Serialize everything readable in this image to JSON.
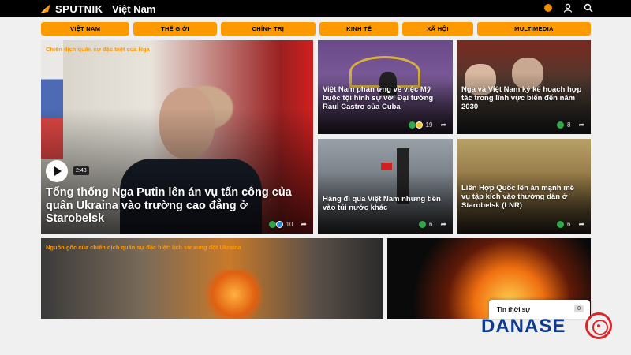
{
  "header": {
    "logo_text": "SPUTNIK",
    "region": "Việt Nam",
    "icons": [
      "status-dot-icon",
      "user-icon",
      "search-icon"
    ]
  },
  "nav": [
    "VIỆT NAM",
    "THẾ GIỚI",
    "CHÍNH TRỊ",
    "KINH TẾ",
    "XÃ HỘI",
    "MULTIMEDIA"
  ],
  "featured": {
    "tag": "Chiến dịch quân sự đặc biệt của Nga",
    "title": "Tổng thống Nga Putin lên án vụ tấn công của quân Ukraina vào trường cao đẳng ở Starobelsk",
    "duration": "2:43",
    "reactions": "10"
  },
  "cards": [
    {
      "title": "Việt Nam phản ứng về việc Mỹ buộc tội hình sự với Đại tướng Raul Castro của Cuba",
      "reactions": "19"
    },
    {
      "title": "Nga và Việt Nam ký kế hoạch hợp tác trong lĩnh vực biển đến năm 2030",
      "reactions": "8"
    },
    {
      "title": "Hàng đi qua Việt Nam nhưng tiền vào túi nước khác",
      "reactions": "6"
    },
    {
      "title": "Liên Hợp Quốc lên án mạnh mẽ vụ tập kích vào thường dân ở Starobelsk (LNR)",
      "reactions": "6"
    }
  ],
  "bottom": {
    "tag": "Nguồn gốc của chiến dịch quân sự đặc biệt: lịch sử xung đột Ukraina"
  },
  "widget": {
    "label": "Tin thời sự",
    "count": "0"
  },
  "brand": {
    "part1": "DANASE",
    "part2": ""
  },
  "colors": {
    "accent": "#ff9900",
    "brand_blue": "#0f3b8f",
    "brand_red": "#d8262b"
  }
}
